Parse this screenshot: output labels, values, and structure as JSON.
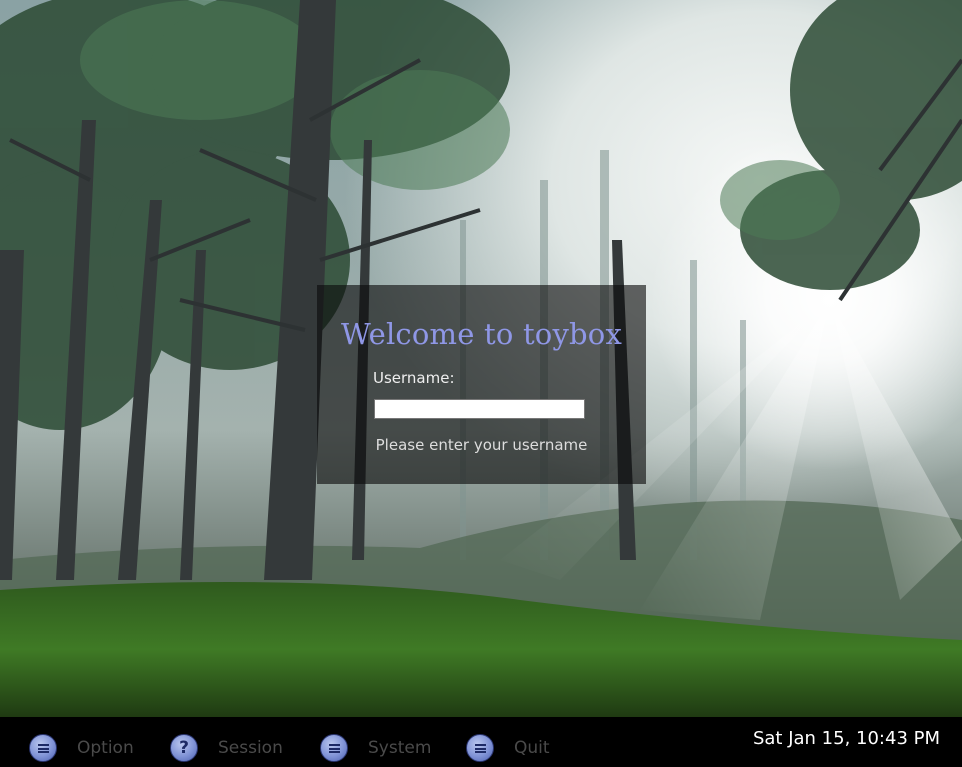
{
  "login": {
    "title": "Welcome to toybox",
    "username_label": "Username:",
    "username_value": "",
    "hint": "Please enter your username"
  },
  "bottom_bar": {
    "buttons": [
      {
        "label": "Option",
        "icon": "menu-lines-icon"
      },
      {
        "label": "Session",
        "icon": "question-icon"
      },
      {
        "label": "System",
        "icon": "menu-lines-icon"
      },
      {
        "label": "Quit",
        "icon": "menu-lines-icon"
      }
    ],
    "clock": "Sat Jan 15, 10:43 PM"
  },
  "colors": {
    "title": "#8f97e6",
    "panel": "#0c0c0c",
    "bar": "#000000",
    "button_icon": "#7f92d6"
  }
}
